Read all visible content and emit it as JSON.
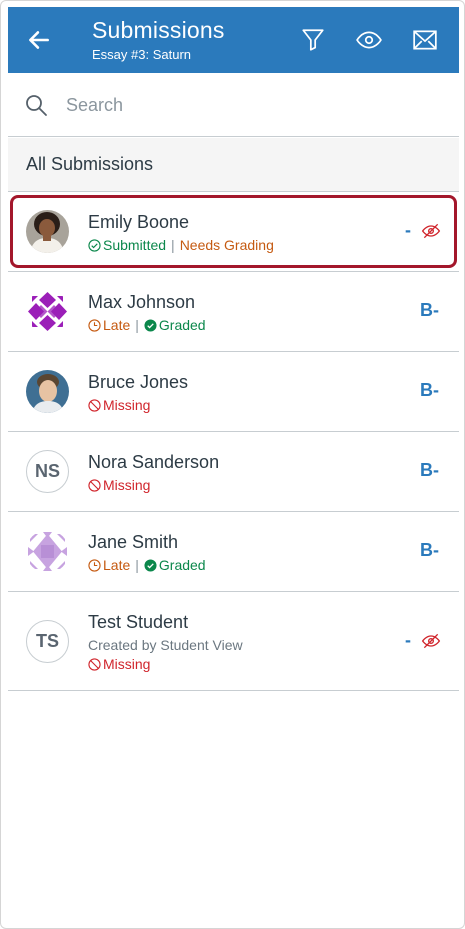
{
  "header": {
    "title": "Submissions",
    "subtitle": "Essay #3: Saturn",
    "background_color": "#2b7abc"
  },
  "search": {
    "placeholder": "Search",
    "value": ""
  },
  "section": {
    "label": "All Submissions"
  },
  "students": [
    {
      "name": "Emily Boone",
      "avatar": "photo",
      "selected": true,
      "status_primary": "Submitted",
      "status_primary_icon": "check-circle-icon",
      "status_secondary": "Needs Grading",
      "grade": "-",
      "grade_hidden": true
    },
    {
      "name": "Max Johnson",
      "avatar": "geometric-pattern-purple",
      "status_primary": "Late",
      "status_primary_icon": "clock-icon",
      "status_secondary": "Graded",
      "status_secondary_icon": "check-filled-icon",
      "grade": "B-"
    },
    {
      "name": "Bruce Jones",
      "avatar": "photo",
      "status_primary": "Missing",
      "status_primary_icon": "no-entry-icon",
      "grade": "B-"
    },
    {
      "name": "Nora Sanderson",
      "avatar_initials": "NS",
      "status_primary": "Missing",
      "status_primary_icon": "no-entry-icon",
      "grade": "B-"
    },
    {
      "name": "Jane Smith",
      "avatar": "geometric-pattern-lavender",
      "status_primary": "Late",
      "status_primary_icon": "clock-icon",
      "status_secondary": "Graded",
      "status_secondary_icon": "check-filled-icon",
      "grade": "B-"
    },
    {
      "name": "Test Student",
      "avatar_initials": "TS",
      "subtext": "Created by Student View",
      "status_primary": "Missing",
      "status_primary_icon": "no-entry-icon",
      "grade": "-",
      "grade_hidden": true
    }
  ],
  "colors": {
    "accent": "#2b7abc",
    "submitted": "#0b874b",
    "late": "#c55a11",
    "missing": "#d0252c",
    "selected_border": "#a3172b"
  }
}
